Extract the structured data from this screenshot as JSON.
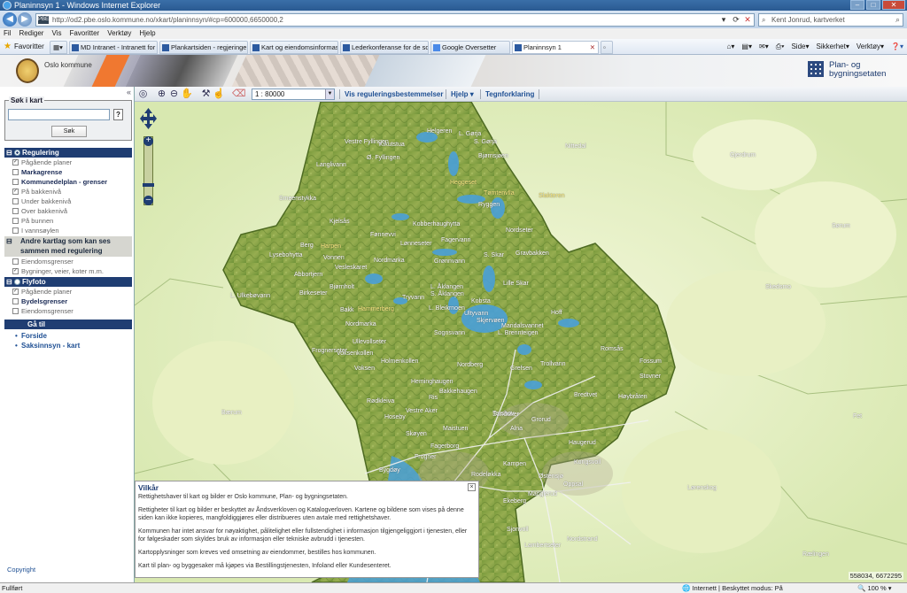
{
  "window": {
    "title": "Planinnsyn 1 - Windows Internet Explorer"
  },
  "browser": {
    "url": "http://od2.pbe.oslo.kommune.no/xkart/planinnsyn/#cp=600000,6650000,2",
    "search_text": "Kent Jonrud, kartverket",
    "menu": [
      "Fil",
      "Rediger",
      "Vis",
      "Favoritter",
      "Verktøy",
      "Hjelp"
    ],
    "favorites_label": "Favoritter",
    "tabs": [
      {
        "label": "MD Intranet - Intranett for ..."
      },
      {
        "label": "Plankartsiden - regjeringe..."
      },
      {
        "label": "Kart og eiendomsinformas..."
      },
      {
        "label": "Lederkonferanse for de so..."
      },
      {
        "label": "Google Oversetter"
      },
      {
        "label": "Planinnsyn 1"
      }
    ],
    "commands": [
      "Side",
      "Sikkerhet",
      "Verktøy"
    ],
    "status": "Fullført",
    "zone": "Internett | Beskyttet modus: På",
    "zoom": "100 %"
  },
  "banner": {
    "org": "Oslo kommune",
    "agency_line1": "Plan- og",
    "agency_line2": "bygningsetaten"
  },
  "toolbar": {
    "scale": "1 : 80000",
    "links": [
      "Vis reguleringsbestemmelser",
      "Hjelp",
      "Tegnforklaring"
    ]
  },
  "sidebar": {
    "search_legend": "Søk i kart",
    "search_button": "Søk",
    "help": "?",
    "sections": {
      "regulering": {
        "title": "Regulering",
        "items": [
          {
            "label": "Pågående planer",
            "checked": true,
            "enabled": false
          },
          {
            "label": "Markagrense",
            "checked": false,
            "enabled": true
          },
          {
            "label": "Kommunedelplan - grenser",
            "checked": false,
            "enabled": true
          },
          {
            "label": "På bakkenivå",
            "checked": true,
            "enabled": false
          },
          {
            "label": "Under bakkenivå",
            "checked": false,
            "enabled": false
          },
          {
            "label": "Over bakkenivå",
            "checked": false,
            "enabled": false
          },
          {
            "label": "På bunnen",
            "checked": false,
            "enabled": false
          },
          {
            "label": "I vannsøylen",
            "checked": false,
            "enabled": false
          }
        ]
      },
      "andre": {
        "title_line1": "Andre kartlag som kan ses",
        "title_line2": "sammen med regulering",
        "items": [
          {
            "label": "Eiendomsgrenser",
            "checked": false
          },
          {
            "label": "Bygninger, veier, koter m.m.",
            "checked": true
          }
        ]
      },
      "flyfoto": {
        "title": "Flyfoto",
        "items": [
          {
            "label": "Pågående planer",
            "checked": true,
            "enabled": false
          },
          {
            "label": "Bydelsgrenser",
            "checked": false,
            "enabled": true
          },
          {
            "label": "Eiendomsgrenser",
            "checked": false,
            "enabled": false
          }
        ]
      }
    },
    "goto": {
      "title": "Gå til",
      "links": [
        "Forside",
        "Saksinnsyn - kart"
      ]
    },
    "copyright": "Copyright"
  },
  "map": {
    "coords": "558034, 6672295",
    "outside_labels": [
      "Nittedal",
      "Gjerdrum",
      "Sørum",
      "Skedsmo",
      "Lørenskog",
      "Rælingen",
      "Fet",
      "Bærum"
    ],
    "place_labels": [
      "Helgeren",
      "L. Gørja",
      "S. Gørja",
      "Kikutstua",
      "Vestre Fyllingen",
      "Ø. Fyllingen",
      "Langlivann",
      "Bjørnsjøen",
      "Heggeset",
      "Tømtenvlla",
      "Slakteren",
      "Ryggen",
      "Smeenstykka",
      "Kjelsås",
      "Kobberhaughytta",
      "Fønnevvi",
      "Lønneseter",
      "Fagervann",
      "Nordseter",
      "Berg",
      "Harpen",
      "Vonnen",
      "Nordmarka",
      "S. Skar",
      "Gravbakken",
      "Vesleskaret",
      "Lysebohytta",
      "Abbortjern",
      "Grønnvann",
      "Lille Skar",
      "L. Ulkebøvann",
      "Bjørnholt",
      "Birkeseter",
      "Tryvann",
      "L. Åklangen",
      "S. Åklangen",
      "Bakk",
      "Hammerberg",
      "L. Bleikrnoen",
      "Kobsta",
      "Nordmarka",
      "Ultyvann",
      "Skjervøen",
      "Maridalsvannet",
      "L. Brennteigen",
      "Hoff",
      "Ullevollseter",
      "Sognsvann",
      "Frognerseter",
      "Voksenkollen",
      "Holmenkollen",
      "Nordberg",
      "Voksen",
      "Grefsen",
      "Heminghaugen",
      "Romsås",
      "Fossum",
      "Trollvann",
      "Stovner",
      "Bakkehaugen",
      "Vestre Aker",
      "Hoseby",
      "Sandaker",
      "Bredtvet",
      "Høybråten",
      "Rødkleiva",
      "Skøyen",
      "Torshov",
      "Grorud",
      "Ris",
      "Maistuen",
      "Alna",
      "Haugerud",
      "Frogner",
      "Fagerborg",
      "Kampen",
      "Østensjø",
      "Oppsal",
      "Bygdøy",
      "Ekeberg",
      "Manglerud",
      "Lambertseter",
      "Nordstrand",
      "Rodeløkka",
      "Kongsvoll",
      "Sjonvoll"
    ]
  },
  "vilkar": {
    "title": "Vilkår",
    "close": "×",
    "p1": "Rettighetshaver til kart og bilder er Oslo kommune, Plan- og bygningsetaten.",
    "p2": "Rettigheter til kart og bilder er beskyttet av Åndsverkloven og Katalogverloven. Kartene og bildene som vises på denne siden kan ikke kopieres, mangfoldiggjøres eller distribueres uten avtale med rettighetshaver.",
    "p3": "Kommunen har intet ansvar for nøyaktighet, pålitelighet eller fullstendighet i informasjon tilgjengeliggjort i tjenesten, eller for følgeskader som skyldes bruk av informasjon eller tekniske avbrudd i tjenesten.",
    "p4": "Kartopplysninger som kreves ved omsetning av eiendommer, bestilles hos kommunen.",
    "p5": "Kart til plan- og byggesaker må kjøpes via Bestillingstjenesten, Infoland eller Kundesenteret."
  }
}
